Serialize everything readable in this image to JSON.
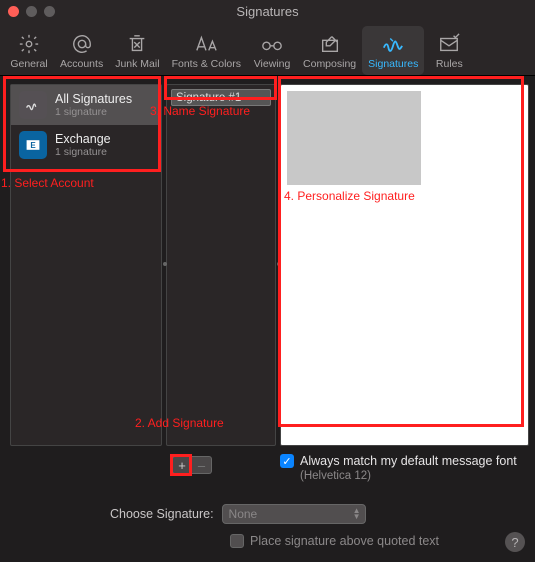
{
  "window": {
    "title": "Signatures"
  },
  "toolbar": {
    "items": [
      {
        "label": "General"
      },
      {
        "label": "Accounts"
      },
      {
        "label": "Junk Mail"
      },
      {
        "label": "Fonts & Colors"
      },
      {
        "label": "Viewing"
      },
      {
        "label": "Composing"
      },
      {
        "label": "Signatures"
      },
      {
        "label": "Rules"
      }
    ]
  },
  "accounts": [
    {
      "title": "All Signatures",
      "subtitle": "1 signature"
    },
    {
      "title": "Exchange",
      "subtitle": "1 signature"
    }
  ],
  "signature_list": {
    "name": "Signature #1"
  },
  "controls": {
    "match_font_label": "Always match my default message font",
    "font_note": "(Helvetica 12)",
    "choose_label": "Choose Signature:",
    "choose_value": "None",
    "place_above_label": "Place signature above quoted text",
    "plus": "+",
    "minus": "–"
  },
  "annotations": {
    "a1": "1. Select Account",
    "a2": "2. Add Signature",
    "a3": "3. Name Signature",
    "a4": "4. Personalize Signature"
  },
  "help": "?"
}
